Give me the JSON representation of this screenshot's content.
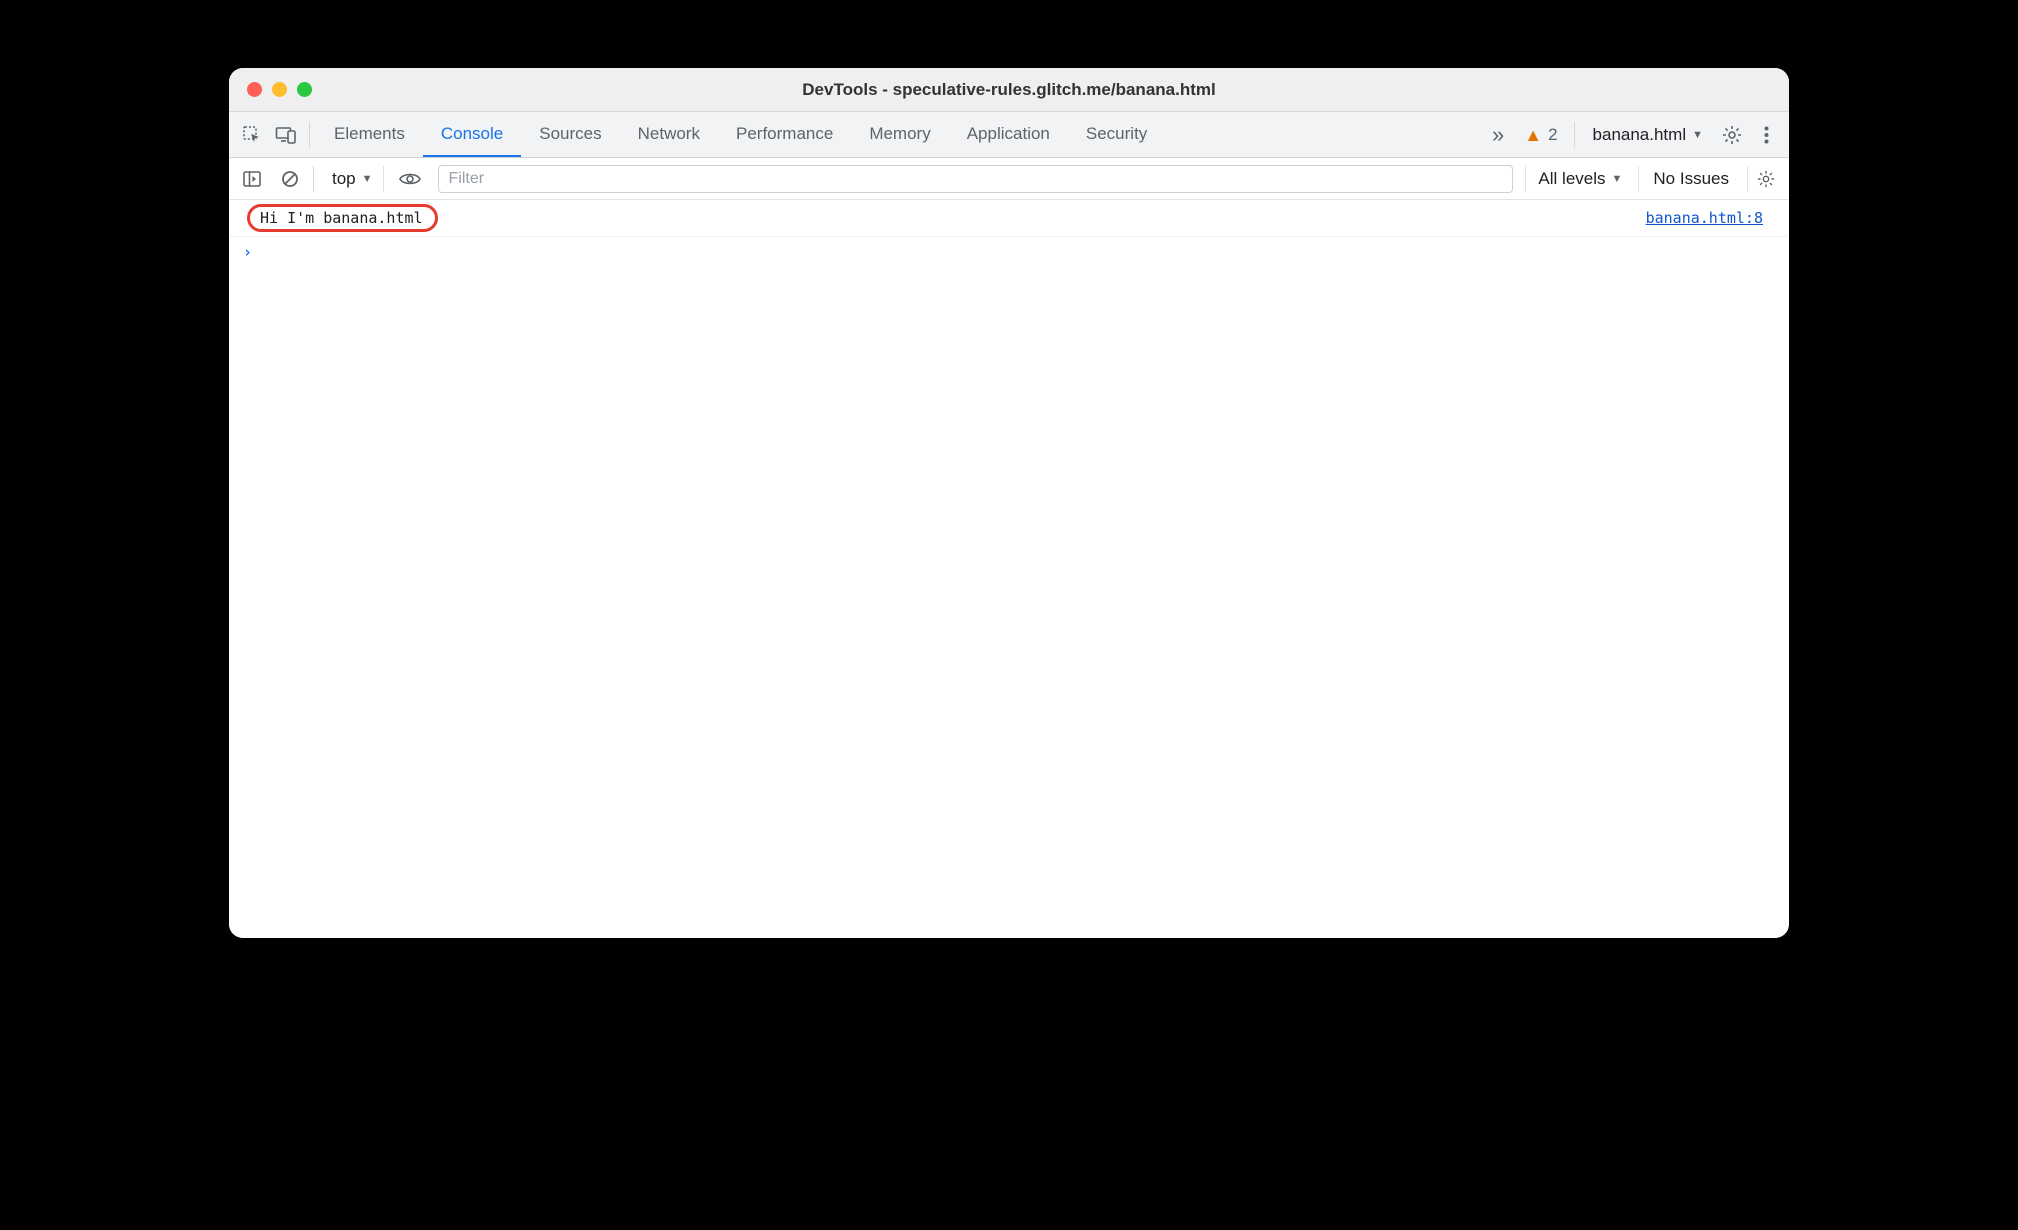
{
  "window": {
    "title": "DevTools - speculative-rules.glitch.me/banana.html"
  },
  "tabs": {
    "items": [
      {
        "label": "Elements"
      },
      {
        "label": "Console"
      },
      {
        "label": "Sources"
      },
      {
        "label": "Network"
      },
      {
        "label": "Performance"
      },
      {
        "label": "Memory"
      },
      {
        "label": "Application"
      },
      {
        "label": "Security"
      }
    ],
    "active": "Console",
    "overflow_glyph": "»",
    "warning_count": "2",
    "target": "banana.html"
  },
  "filterbar": {
    "context": "top",
    "filter_placeholder": "Filter",
    "filter_value": "",
    "levels": "All levels",
    "issues": "No Issues"
  },
  "console": {
    "log_message": "Hi I'm banana.html",
    "source_link": "banana.html:8",
    "prompt_glyph": "›"
  }
}
